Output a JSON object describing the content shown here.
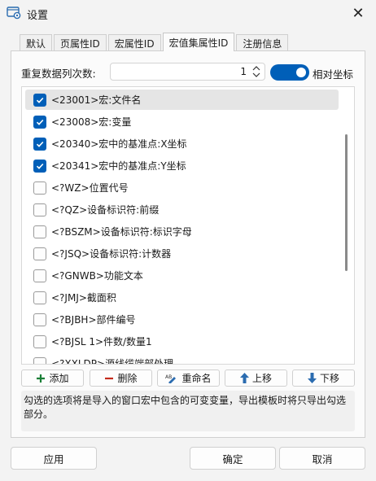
{
  "window": {
    "title": "设置",
    "close_glyph": "✕"
  },
  "tabs": [
    {
      "label": "默认",
      "active": false
    },
    {
      "label": "页属性ID",
      "active": false
    },
    {
      "label": "宏属性ID",
      "active": false
    },
    {
      "label": "宏值集属性ID",
      "active": true
    },
    {
      "label": "注册信息",
      "active": false
    }
  ],
  "repeat": {
    "label": "重复数据列次数:",
    "value": "1"
  },
  "relative_coords": {
    "label": "相对坐标",
    "on": true
  },
  "list": {
    "items": [
      {
        "label": "<23001>宏:文件名",
        "checked": true,
        "selected": true
      },
      {
        "label": "<23008>宏:变量",
        "checked": true,
        "selected": false
      },
      {
        "label": "<20340>宏中的基准点:X坐标",
        "checked": true,
        "selected": false
      },
      {
        "label": "<20341>宏中的基准点:Y坐标",
        "checked": true,
        "selected": false
      },
      {
        "label": "<?WZ>位置代号",
        "checked": false,
        "selected": false
      },
      {
        "label": "<?QZ>设备标识符:前缀",
        "checked": false,
        "selected": false
      },
      {
        "label": "<?BSZM>设备标识符:标识字母",
        "checked": false,
        "selected": false
      },
      {
        "label": "<?JSQ>设备标识符:计数器",
        "checked": false,
        "selected": false
      },
      {
        "label": "<?GNWB>功能文本",
        "checked": false,
        "selected": false
      },
      {
        "label": "<?JMJ>截面积",
        "checked": false,
        "selected": false
      },
      {
        "label": "<?BJBH>部件编号",
        "checked": false,
        "selected": false
      },
      {
        "label": "<?BJSL 1>件数/数量1",
        "checked": false,
        "selected": false
      },
      {
        "label": "<?XXLDP>源线缆端部处理",
        "checked": false,
        "selected": false
      }
    ]
  },
  "actions": {
    "add": "添加",
    "delete": "删除",
    "rename": "重命名",
    "move_up": "上移",
    "move_down": "下移"
  },
  "description": "勾选的选项将是导入的窗口宏中包含的可变变量，导出模板时将只导出勾选部分。",
  "footer": {
    "apply": "应用",
    "ok": "确定",
    "cancel": "取消"
  },
  "colors": {
    "accent": "#005fb8",
    "add_green": "#1a7f37",
    "delete_red": "#c42b1c",
    "background": "#f3f3f3"
  },
  "icons": {
    "app": "settings-window-icon",
    "add": "plus-icon",
    "delete": "minus-icon",
    "rename": "rename-icon",
    "up": "arrow-up-icon",
    "down": "arrow-down-icon"
  }
}
